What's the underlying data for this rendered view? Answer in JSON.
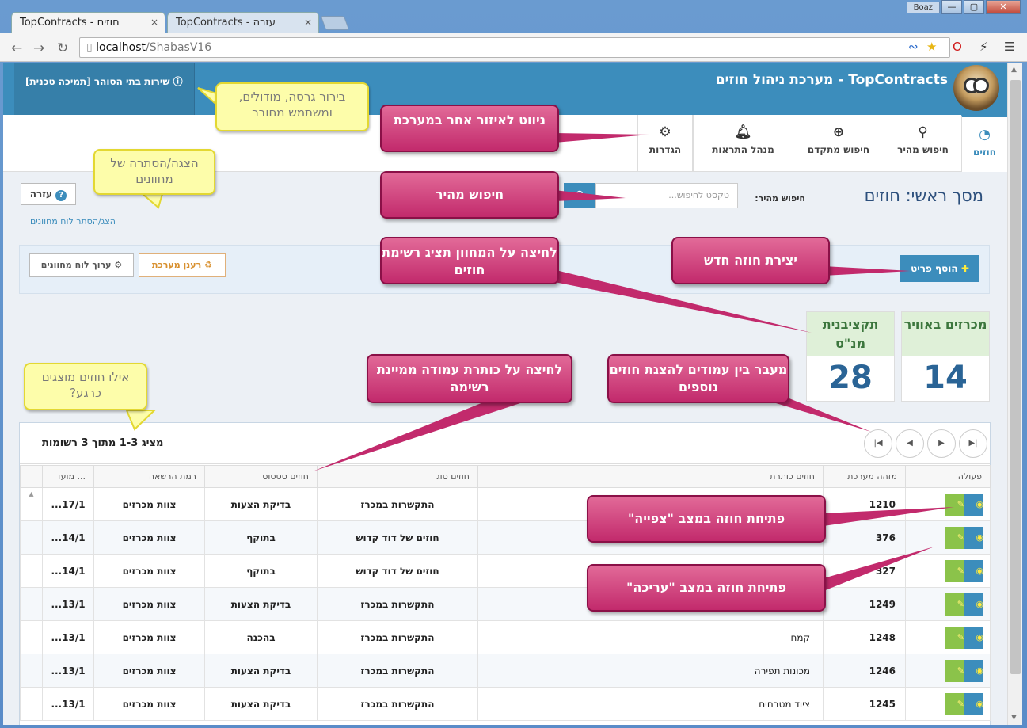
{
  "browser": {
    "tabs": [
      {
        "label": "TopContracts - חוזים",
        "close": "×"
      },
      {
        "label": "TopContracts - עזרה",
        "close": "×"
      }
    ],
    "user": "Boaz",
    "window_buttons": [
      "—",
      "▢",
      "✕"
    ],
    "url_host": "localhost",
    "url_path": "/ShabasV16"
  },
  "app": {
    "brand": "TopContracts - מערכת ניהול חוזים",
    "support_link": "שירות בתי הסוהר [תמיכה טכנית]",
    "nav": [
      {
        "label": "חוזים",
        "icon": "dashboard-icon",
        "active": true
      },
      {
        "label": "חיפוש מהיר",
        "icon": "search-icon"
      },
      {
        "label": "חיפוש מתקדם",
        "icon": "zoom-in-icon"
      },
      {
        "label": "מנהל התראות",
        "icon": "bell-icon"
      },
      {
        "label": "הגדרות",
        "icon": "gear-icon"
      }
    ],
    "page_title": "מסך ראשי: חוזים",
    "quick_search_label": "חיפוש מהיר:",
    "quick_search_placeholder": "טקסט לחיפוש...",
    "help_button": "עזרה",
    "toggle_dashboard_link": "הצג/הסתר לוח מחוונים",
    "add_button": "הוסף פריט",
    "refresh_button": "רענן מערכת",
    "edit_dashboard_button": "ערוך לוח מחוונים",
    "widgets": [
      {
        "title": "מכרזים באוויר",
        "count": "14"
      },
      {
        "title": "תקציבנית מנ\"ט",
        "count": "28"
      }
    ],
    "list_count": "מציג 1-3 מתוך 3 רשומות",
    "columns": [
      "פעולה",
      "מזהה מערכת",
      "חוזים כותרת",
      "חוזים סוג",
      "חוזים סטטוס",
      "רמת הרשאה",
      "מועד ..."
    ],
    "rows": [
      {
        "id": "1210",
        "title": "",
        "type": "התקשרות במכרז",
        "status": "בדיקת הצעות",
        "perm": "צוות מכרזים",
        "date": "17/1..."
      },
      {
        "id": "376",
        "title": "",
        "type": "חוזים של דוד קדוש",
        "status": "בתוקף",
        "perm": "צוות מכרזים",
        "date": "14/1..."
      },
      {
        "id": "327",
        "title": "",
        "type": "חוזים של דוד קדוש",
        "status": "בתוקף",
        "perm": "צוות מכרזים",
        "date": "14/1..."
      },
      {
        "id": "1249",
        "title": "",
        "type": "התקשרות במכרז",
        "status": "בדיקת הצעות",
        "perm": "צוות מכרזים",
        "date": "13/1..."
      },
      {
        "id": "1248",
        "title": "קמח",
        "type": "התקשרות במכרז",
        "status": "בהכנה",
        "perm": "צוות מכרזים",
        "date": "13/1..."
      },
      {
        "id": "1246",
        "title": "מכונות תפירה",
        "type": "התקשרות במכרז",
        "status": "בדיקת הצעות",
        "perm": "צוות מכרזים",
        "date": "13/1..."
      },
      {
        "id": "1245",
        "title": "ציוד מטבחים",
        "type": "התקשרות במכרז",
        "status": "בדיקת הצעות",
        "perm": "צוות מכרזים",
        "date": "13/1..."
      }
    ]
  },
  "annotations": {
    "version_tip": "בירור גרסה, מודולים, ומשתמש מחובר",
    "toggle_tip": "הצגה/הסתרה של מחוונים",
    "which_tip": "אילו חוזים מוצגים כרגע?",
    "navigate": "ניווט לאיזור אחר במערכת",
    "quick_search": "חיפוש מהיר",
    "widget_click": "לחיצה על המחוון תציג רשימת חוזים",
    "new_contract": "יצירת חוזה חדש",
    "sort_column": "לחיצה על כותרת עמודה ממיינת רשימה",
    "paging": "מעבר בין עמודים להצגת חוזים נוספים",
    "open_view": "פתיחת חוזה במצב \"צפייה\"",
    "open_edit": "פתיחת חוזה במצב \"עריכה\""
  },
  "colors": {
    "accent": "#3c8dbc",
    "callout": "#c22a6c",
    "tip": "#fdfdaa",
    "widget_green": "#dff0d8"
  }
}
